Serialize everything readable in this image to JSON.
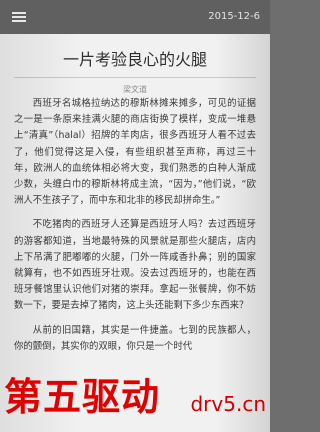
{
  "header": {
    "menu_icon": "menu-icon",
    "date": "2015-12-6"
  },
  "article": {
    "title": "一片考验良心的火腿",
    "author": "梁文道",
    "paragraphs": [
      "西班牙名城格拉纳达的穆斯林摊来摊多，可见的证据之一是一条原来挂满火腿的商店街换了模样，变成一堆悬上“清真”（halal）招牌的羊肉店，很多西班牙人看不过去了，他们觉得这是入侵，有些组织甚至声称，再过三十年，欧洲人的血统体相必将大变，我们熟悉的白种人渐成少数，头缠白巾的穆斯林将成主流，“因为，”他们说，“欧洲人不生孩子了，而中东和北非的移民却拼命生。”",
      "不吃猪肉的西班牙人还算是西班牙人吗？去过西班牙的游客都知道，当地最特殊的风景就是那些火腿店，店内上下吊满了肥嘟嘟的火腿，门外一阵咸香扑鼻；别的国家就算有，也不如西班牙壮观。没去过西班牙的，也能在西班牙餐馆里认识他们对猪的崇拜。拿起一张餐牌，你不妨数一下，要是去掉了猪肉，这上头还能剩下多少东西来？",
      "从前的旧国籍，其实是一件捷盖。七到的民族都人，你的颤倒，其实你的双眼，你只是一个时代"
    ]
  },
  "watermark": {
    "cn": "第五驱动",
    "en": "drv5.cn"
  }
}
